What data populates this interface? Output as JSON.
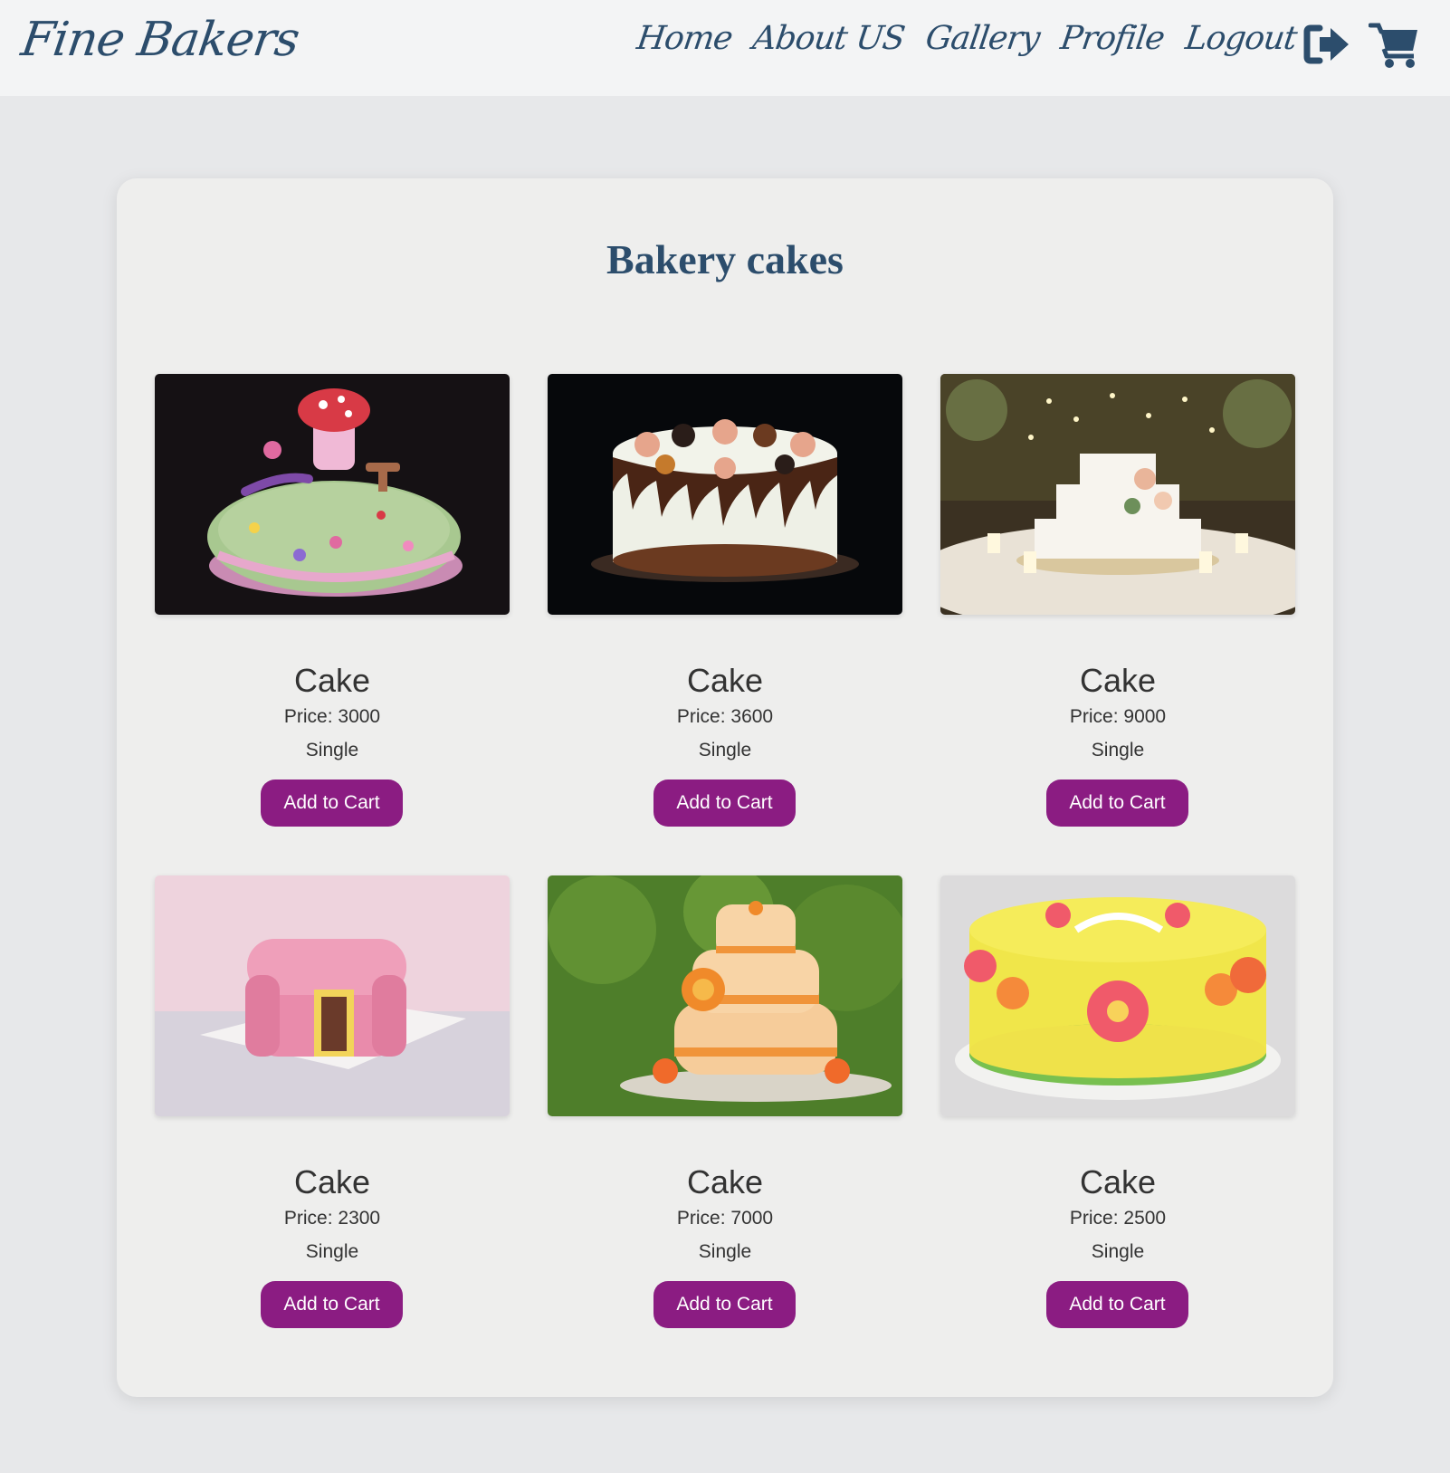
{
  "header": {
    "brand": "Fine Bakers",
    "nav": [
      {
        "label": "Home"
      },
      {
        "label": "About US"
      },
      {
        "label": "Gallery"
      },
      {
        "label": "Profile"
      },
      {
        "label": "Logout"
      }
    ],
    "icons": {
      "logout": "logout-icon",
      "cart": "shopping-cart-icon"
    }
  },
  "main": {
    "title": "Bakery cakes",
    "products": [
      {
        "name": "Cake",
        "price": "Price: 3000",
        "type": "Single",
        "button": "Add to Cart",
        "image": "fairy-garden-mushroom-cake"
      },
      {
        "name": "Cake",
        "price": "Price: 3600",
        "type": "Single",
        "button": "Add to Cart",
        "image": "chocolate-drip-cookie-cake"
      },
      {
        "name": "Cake",
        "price": "Price: 9000",
        "type": "Single",
        "button": "Add to Cart",
        "image": "tiered-wedding-cake-candles"
      },
      {
        "name": "Cake",
        "price": "Price: 2300",
        "type": "Single",
        "button": "Add to Cart",
        "image": "pink-armchair-cake"
      },
      {
        "name": "Cake",
        "price": "Price: 7000",
        "type": "Single",
        "button": "Add to Cart",
        "image": "orange-rose-tiered-cake"
      },
      {
        "name": "Cake",
        "price": "Price: 2500",
        "type": "Single",
        "button": "Add to Cart",
        "image": "yellow-flower-cake"
      }
    ]
  },
  "colors": {
    "brand_blue": "#2c4d6c",
    "button_purple": "#8b1c82",
    "page_background": "#e7e8ea",
    "card_background": "#eeeeed"
  }
}
